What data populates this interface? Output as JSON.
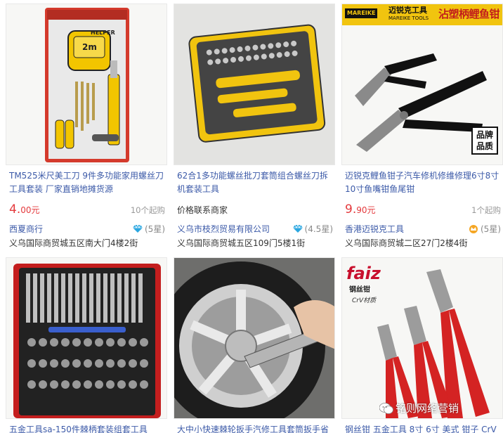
{
  "products": [
    {
      "title": "TM525米尺美工刀 9件多功能家用螺丝刀工具套装 厂家直销地摊货源",
      "price_int": "4.",
      "price_dec": "00",
      "price_unit": "元",
      "moq": "10个起购",
      "shop": "西夏商行",
      "rating": "(5星)",
      "address": "义乌国际商贸城五区南大门4楼2街",
      "package_text": "HELPER",
      "tape_text": "2m"
    },
    {
      "title": "62合1多功能螺丝批刀套筒组合螺丝刀拆机套装工具",
      "price_text": "价格联系商家",
      "shop": "义乌市枝烈贸易有限公司",
      "rating": "(4.5星)",
      "address": "义乌国际商贸城五区109门5楼1街"
    },
    {
      "title": "迈锐克鲤鱼钳子汽车修机修维修理6寸8寸10寸鱼嘴钳鱼尾钳",
      "price_int": "9.",
      "price_dec": "90",
      "price_unit": "元",
      "moq": "1个起购",
      "shop": "香港迈锐克工具",
      "rating": "(5星)",
      "address": "义乌国际商贸城二区27门2楼4街",
      "brand_logo": "MAREIKE",
      "brand_cn": "迈锐克工具",
      "brand_en": "MAREIKE TOOLS",
      "brand_slogan": "沾塑柄鲤鱼钳",
      "quality_badge": "品牌品质"
    },
    {
      "title": "五金工具sa-150件棘柄套装组套工具"
    },
    {
      "title": "大中小快速棘轮扳手汽修工具套筒扳手省"
    },
    {
      "title": "钢丝钳 五金工具 8寸 6寸 美式 钳子 CrV",
      "brand": "faiz",
      "sub": "钢丝钳",
      "crv": "CrV材质"
    }
  ],
  "watermark": "铭则网络营销",
  "colors": {
    "link": "#3c5aa8",
    "price": "#e4393c",
    "muted": "#999999",
    "diamond": "#2aa6e0"
  }
}
